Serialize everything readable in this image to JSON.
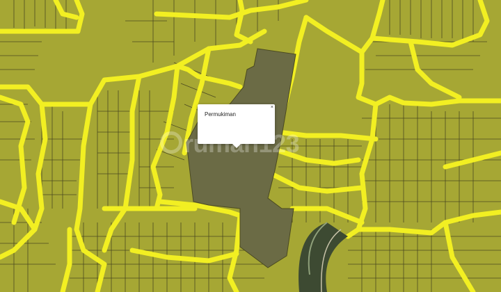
{
  "map": {
    "popup": {
      "title": "Permukiman",
      "close_symbol": "×"
    },
    "watermark": {
      "text": "rumah123",
      "icon": "rumah123-logo-icon"
    },
    "colors": {
      "parcel_fill": "#a6a734",
      "roads": "#f2ef22",
      "parcel_lines": "#4b4a20",
      "selected_area": "#6b6b45",
      "satellite_patch": "#3d4a32"
    }
  }
}
